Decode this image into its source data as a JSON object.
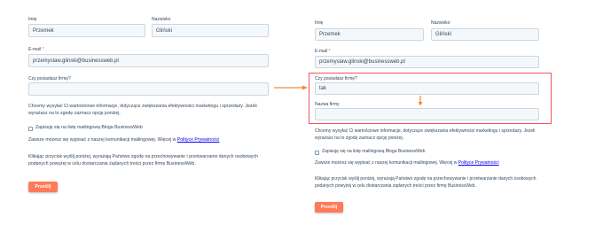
{
  "colors": {
    "accent": "#ff7a59",
    "highlight": "#f2545b",
    "arrow": "#f08a3c",
    "field_bg": "#f5f8fa",
    "field_border": "#cbd6e2"
  },
  "left": {
    "first_name_label": "Imię",
    "last_name_label": "Nazwisko",
    "first_name_value": "Przemek",
    "last_name_value": "Gliński",
    "email_label": "E-mail",
    "email_required": "*",
    "email_value": "przemyslaw.glinski@businessweb.pl",
    "company_question_label": "Czy posiadasz firmę?",
    "company_question_value": "",
    "consent_text": "Chcemy wysyłać Ci wartościowe informacje, dotyczące zwiększania efektywności marketingu i sprzedaży. Jeżeli wyrażasz na to zgodę zaznacz opcję poniżej.",
    "checkbox_label": "Zapisuję się na listę mailingową Bloga BusinessWeb",
    "unsubscribe_text": "Zawsze możesz się wypisać z naszej komunikacji mailingowej. Więcej w",
    "privacy_link": "Polityce Prywatności",
    "submit_note": "Klikając przycisk wyślij poniżej, wyrażają Państwo zgodę na przechowywanie i przetwarzanie danych osobowych podanych powyżej w celu dostarczania żądanych treści przez firmę BusinessWeb.",
    "submit_label": "Prześlij"
  },
  "right": {
    "first_name_label": "Imię",
    "last_name_label": "Nazwisko",
    "first_name_value": "Przemek",
    "last_name_value": "Gliński",
    "email_label": "E-mail",
    "email_required": "*",
    "email_value": "przemyslaw.glinski@businessweb.pl",
    "company_question_label": "Czy posiadasz firmę?",
    "company_question_value": "tak",
    "company_name_label": "Nazwa firmy",
    "company_name_value": "",
    "consent_text": "Chcemy wysyłać Ci wartościowe informacje, dotyczące zwiększania efektywności marketingu i sprzedaży. Jeżeli wyrażasz na to zgodę zaznacz opcję poniżej.",
    "checkbox_label": "Zapisuję się na listę mailingową Bloga BusinessWeb",
    "unsubscribe_text": "Zawsze możesz się wypisać z naszej komunikacji mailingowej. Więcej w",
    "privacy_link": "Polityce Prywatności",
    "submit_note": "Klikając przycisk wyślij poniżej, wyrażają Państwo zgodę na przechowywanie i przetwarzanie danych osobowych podanych powyżej w celu dostarczania żądanych treści przez firmę BusinessWeb.",
    "submit_label": "Prześlij"
  }
}
